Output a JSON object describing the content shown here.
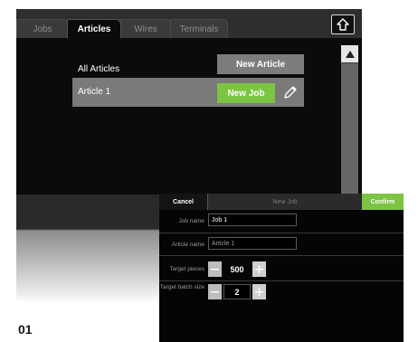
{
  "tabs": [
    {
      "label": "Jobs",
      "active": false
    },
    {
      "label": "Articles",
      "active": true
    },
    {
      "label": "Wires",
      "active": false
    },
    {
      "label": "Terminals",
      "active": false
    }
  ],
  "home_icon": "home-outline-icon",
  "articles": {
    "list_title": "All Articles",
    "new_article_label": "New Article",
    "items": [
      {
        "label": "Article 1",
        "new_job_label": "New Job",
        "edit_icon": "pencil-icon"
      }
    ]
  },
  "scrollbar": {
    "up_icon": "triangle-up-icon"
  },
  "dialog": {
    "cancel_label": "Cancel",
    "title": "New Job",
    "confirm_label": "Confirm",
    "job_name": {
      "label": "Job name",
      "value": "Job 1"
    },
    "article_name": {
      "label": "Article name",
      "value": "Article 1"
    },
    "target_pieces": {
      "label": "Target pieces",
      "value": "500"
    },
    "target_batch": {
      "label": "Target batch size",
      "value": "2"
    }
  },
  "figure_label": "01",
  "colors": {
    "accent_green": "#7cc442",
    "screen_bg": "#0b0b0b",
    "row_gray": "#7a7a7a"
  }
}
